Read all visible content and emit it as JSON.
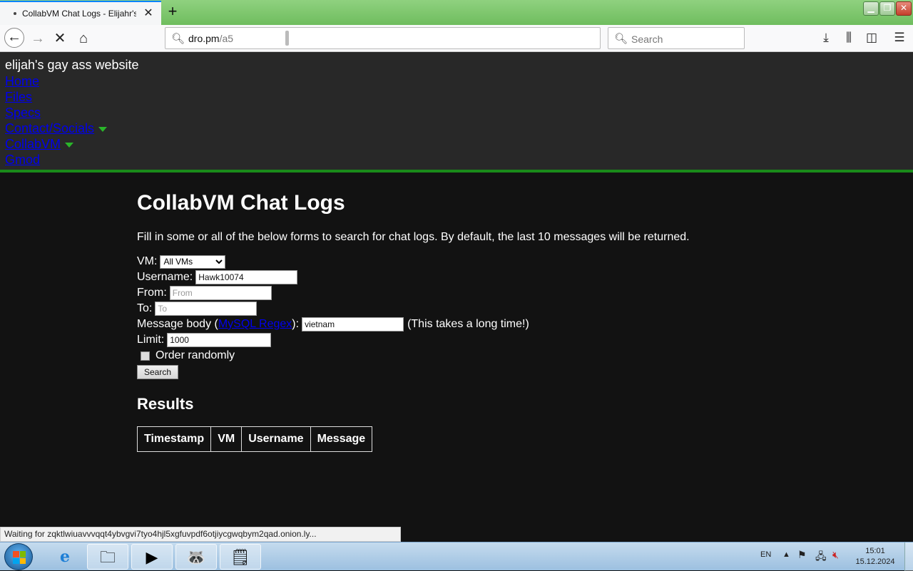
{
  "browser": {
    "tab_title": "CollabVM Chat Logs - Elijahr's",
    "new_tab": "+",
    "url_host": "dro.pm",
    "url_path": "/a5",
    "search_placeholder": "Search"
  },
  "site": {
    "name": "elijah's gay ass website",
    "nav": [
      "Home",
      "Files",
      "Specs",
      "Contact/Socials",
      "CollabVM",
      "Gmod"
    ]
  },
  "main": {
    "title": "CollabVM Chat Logs",
    "description": "Fill in some or all of the below forms to search for chat logs. By default, the last 10 messages will be returned.",
    "vm_label": "VM:",
    "vm_selected": "All VMs",
    "username_label": "Username:",
    "username_value": "Hawk10074",
    "from_label": "From:",
    "from_placeholder": "From",
    "to_label": "To:",
    "to_placeholder": "To",
    "message_label_pre": "Message body (",
    "message_link": "MySQL Regex",
    "message_label_post": "):",
    "message_value": "vietnam",
    "message_note": "(This takes a long time!)",
    "limit_label": "Limit:",
    "limit_value": "1000",
    "order_label": "Order randomly",
    "search_button": "Search",
    "results_heading": "Results",
    "columns": [
      "Timestamp",
      "VM",
      "Username",
      "Message"
    ]
  },
  "status_text": "Waiting for zqktlwiuavvvqqt4ybvgvi7tyo4hjl5xgfuvpdf6otjiycgwqbym2qad.onion.ly...",
  "taskbar": {
    "lang": "EN",
    "time": "15:01",
    "date": "15.12.2024"
  }
}
